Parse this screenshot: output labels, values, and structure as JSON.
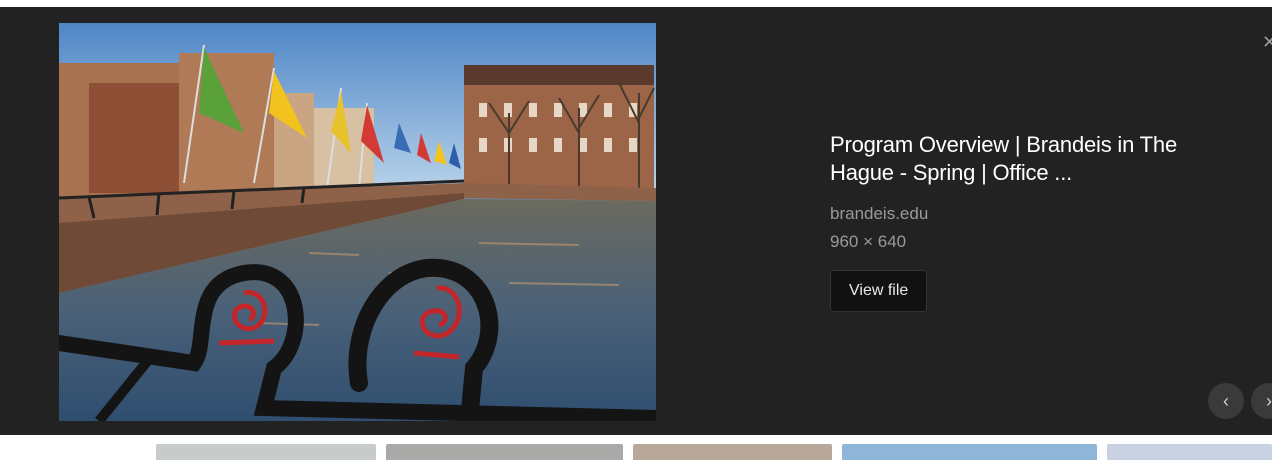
{
  "result": {
    "title": "Program Overview | Brandeis in The Hague - Spring | Office ...",
    "source": "brandeis.edu",
    "dimensions": "960 × 640",
    "view_file_label": "View file"
  },
  "controls": {
    "close_icon": "close-icon",
    "prev_icon": "chevron-left-icon",
    "next_icon": "chevron-right-icon"
  },
  "thumbnails": [
    {
      "name": "thumbnail-1",
      "color": "#c7cbc9"
    },
    {
      "name": "thumbnail-2",
      "color": "#a9a9a7"
    },
    {
      "name": "thumbnail-3",
      "color": "#b8a89a"
    },
    {
      "name": "thumbnail-4",
      "color": "#8fb5d8"
    },
    {
      "name": "thumbnail-5",
      "color": "#c9d2e2"
    }
  ],
  "colors": {
    "panel_bg": "#222222",
    "button_bg": "#111111",
    "muted_text": "#9a9a9a"
  }
}
